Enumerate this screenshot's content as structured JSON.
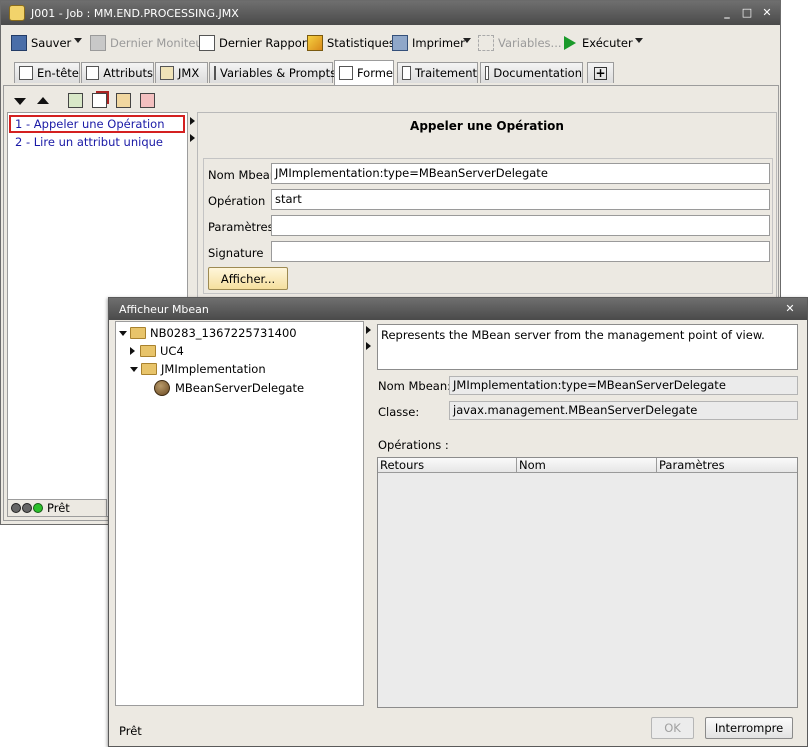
{
  "main_window": {
    "title": "J001 - Job : MM.END.PROCESSING.JMX",
    "toolbar": {
      "save": "Sauver",
      "last_monitor": "Dernier Moniteur",
      "last_report": "Dernier Rapport",
      "statistics": "Statistiques",
      "print": "Imprimer",
      "variables": "Variables...",
      "execute": "Exécuter"
    },
    "tabs": [
      "En-tête",
      "Attributs",
      "JMX",
      "Variables & Prompts",
      "Forme",
      "Traitement",
      "Documentation"
    ],
    "steps": [
      "1 - Appeler une Opération",
      "2 - Lire un attribut unique"
    ],
    "form": {
      "title": "Appeler une Opération",
      "mbean_name_label": "Nom Mbean",
      "mbean_name_value": "JMImplementation:type=MBeanServerDelegate",
      "operation_label": "Opération",
      "operation_value": "start",
      "parameters_label": "Paramètres",
      "parameters_value": "",
      "signature_label": "Signature",
      "signature_value": "",
      "display_button": "Afficher..."
    },
    "status": "Prêt"
  },
  "mbean_dialog": {
    "title": "Afficheur Mbean",
    "tree": {
      "root": "NB0283_1367225731400",
      "children": [
        {
          "label": "UC4",
          "expanded": false
        },
        {
          "label": "JMImplementation",
          "expanded": true,
          "children": [
            "MBeanServerDelegate"
          ]
        }
      ]
    },
    "description": "Represents  the MBean server from the management point of view.",
    "mbean_name_label": "Nom Mbean:",
    "mbean_name_value": "JMImplementation:type=MBeanServerDelegate",
    "class_label": "Classe:",
    "class_value": "javax.management.MBeanServerDelegate",
    "operations_label": "Opérations :",
    "columns": [
      "Retours",
      "Nom",
      "Paramètres"
    ],
    "status": "Prêt",
    "ok_button": "OK",
    "cancel_button": "Interrompre"
  },
  "colors": {
    "titlebar": "#5a5a5a",
    "window_bg": "#ece9e2",
    "selected_step_border": "#d42020",
    "link_text": "#1a1aa6",
    "display_button": "#fff0c8"
  }
}
